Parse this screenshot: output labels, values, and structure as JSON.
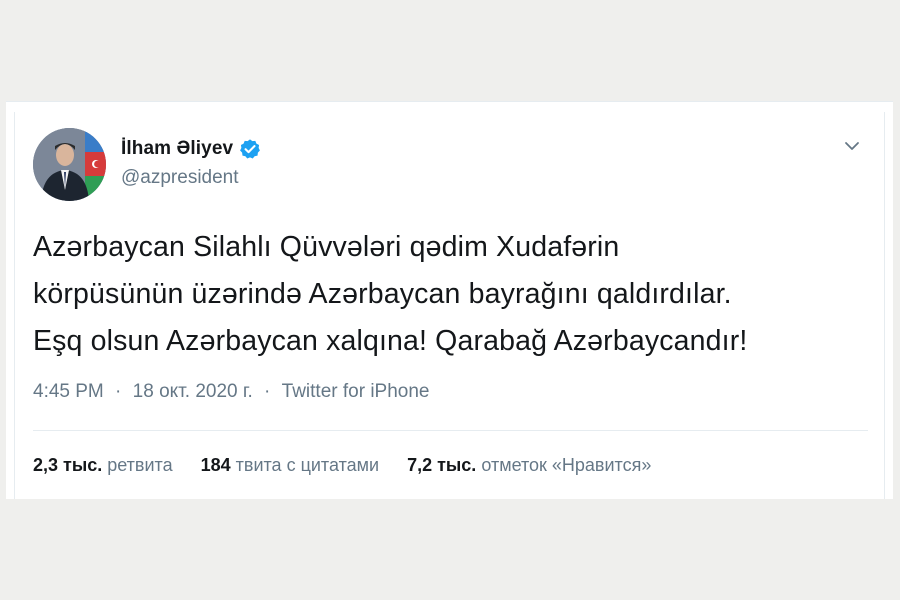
{
  "tweet": {
    "display_name": "İlham Əliyev",
    "handle": "@azpresident",
    "verified": true,
    "text_lines": [
      "Azərbaycan Silahlı Qüvvələri qədim Xudafərin",
      "körpüsünün üzərində Azərbaycan bayrağını qaldırdılar.",
      "Eşq olsun Azərbaycan xalqına! Qarabağ Azərbaycandır!"
    ],
    "time": "4:45 PM",
    "date": "18 окт. 2020 г.",
    "source": "Twitter for iPhone",
    "separator": "·"
  },
  "stats": {
    "retweets_count": "2,3 тыс.",
    "retweets_label": "ретвита",
    "quotes_count": "184",
    "quotes_label": "твита с цитатами",
    "likes_count": "7,2 тыс.",
    "likes_label": "отметок «Нравится»"
  },
  "icons": {
    "verified": "verified-badge-icon",
    "caret": "chevron-down-icon"
  },
  "colors": {
    "verified_blue": "#1da1f2",
    "text_primary": "#14171a",
    "text_secondary": "#657786"
  }
}
